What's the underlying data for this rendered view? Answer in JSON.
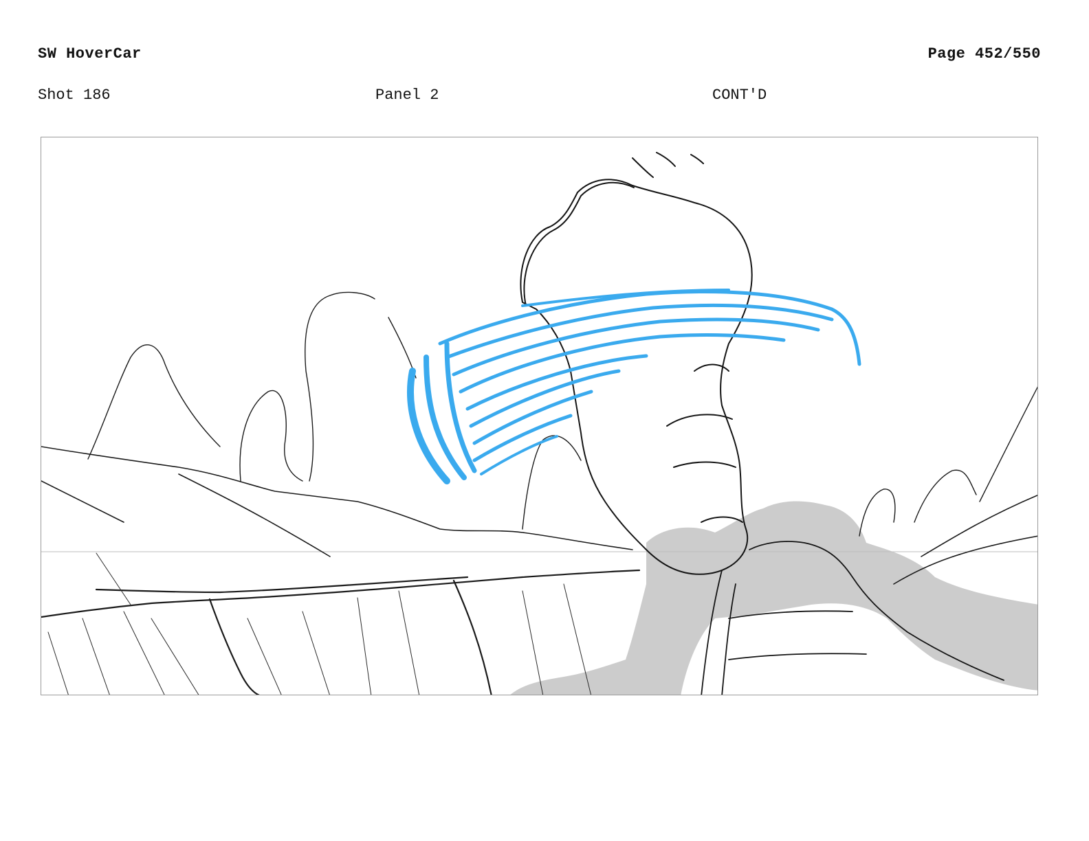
{
  "header": {
    "title": "SW HoverCar",
    "page": "Page 452/550"
  },
  "shot_info": {
    "shot": "Shot 186",
    "panel": "Panel 2",
    "continuity": "CONT'D"
  },
  "colors": {
    "sketch_line": "#1a1a1a",
    "effect_blue": "#3aaaee",
    "smoke_gray": "#cccccc",
    "horizon_line": "#bdbdbd"
  }
}
